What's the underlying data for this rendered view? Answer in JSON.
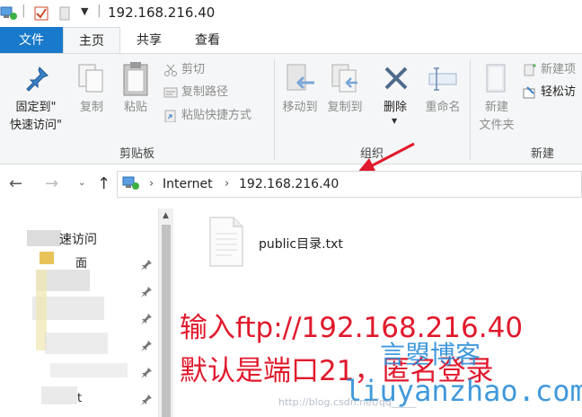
{
  "window": {
    "title": "192.168.216.40"
  },
  "ribbon_tabs": [
    {
      "id": "file",
      "label": "文件"
    },
    {
      "id": "home",
      "label": "主页"
    },
    {
      "id": "share",
      "label": "共享"
    },
    {
      "id": "view",
      "label": "查看"
    }
  ],
  "clipboard": {
    "pin_label_line1": "固定到\"",
    "pin_label_line2": "快速访问\"",
    "copy_label": "复制",
    "paste_label": "粘贴",
    "cut_label": "剪切",
    "copy_path_label": "复制路径",
    "paste_shortcut_label": "粘贴快捷方式",
    "group_label": "剪贴板"
  },
  "organize": {
    "move_to_label": "移动到",
    "copy_to_label": "复制到",
    "delete_label": "删除",
    "rename_label": "重命名",
    "group_label": "组织"
  },
  "new_group": {
    "new_folder_line1": "新建",
    "new_folder_line2": "文件夹",
    "new_item_label": "新建项",
    "easy_access_label": "轻松访",
    "group_label": "新建"
  },
  "address": {
    "crumbs": [
      "Internet",
      "192.168.216.40"
    ]
  },
  "nav_pane": {
    "quick_access_label": "速访问",
    "partial_1": "面",
    "partial_2": "t"
  },
  "content": {
    "files": [
      {
        "name": "public目录.txt"
      }
    ]
  },
  "watermark": {
    "line1": "输入ftp://192.168.216.40",
    "line2": "默认是端口21，匿名登录",
    "site_cn": "言曌博客",
    "site_en": "liuyanzhao.com",
    "blog_url": "http://blog.csdn.net/qq_____"
  },
  "colors": {
    "accent": "#1979ca",
    "watermark_red": "#e1192c",
    "watermark_blue": "#2d8fd8"
  }
}
